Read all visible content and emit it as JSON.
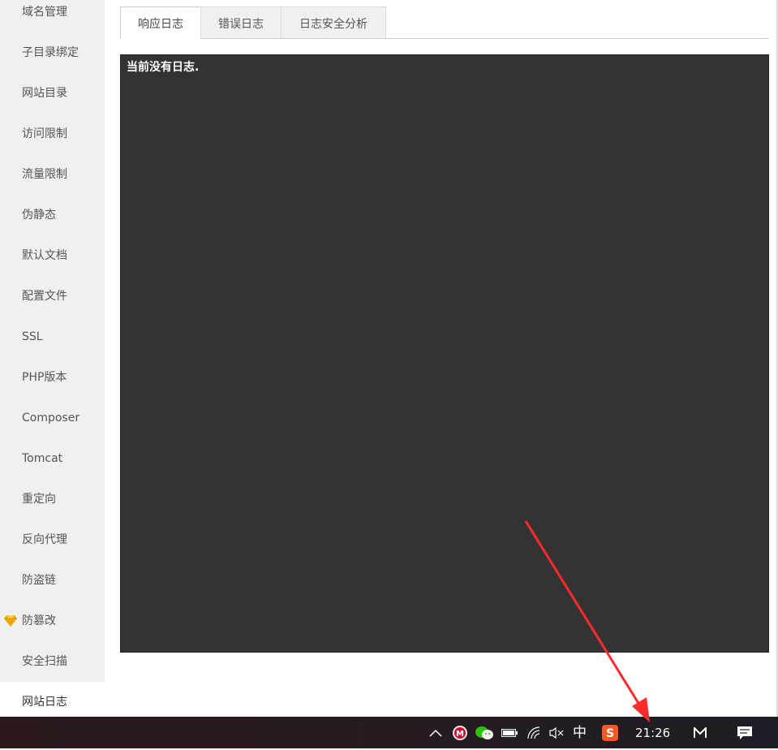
{
  "sidebar": {
    "items": [
      {
        "label": "域名管理"
      },
      {
        "label": "子目录绑定"
      },
      {
        "label": "网站目录"
      },
      {
        "label": "访问限制"
      },
      {
        "label": "流量限制"
      },
      {
        "label": "伪静态"
      },
      {
        "label": "默认文档"
      },
      {
        "label": "配置文件"
      },
      {
        "label": "SSL"
      },
      {
        "label": "PHP版本"
      },
      {
        "label": "Composer"
      },
      {
        "label": "Tomcat"
      },
      {
        "label": "重定向"
      },
      {
        "label": "反向代理"
      },
      {
        "label": "防盗链"
      },
      {
        "label": "防篡改"
      },
      {
        "label": "安全扫描"
      },
      {
        "label": "网站日志"
      }
    ],
    "active_index": 17,
    "premium_icon_color": "#f0a800"
  },
  "tabs": [
    {
      "label": "响应日志"
    },
    {
      "label": "错误日志"
    },
    {
      "label": "日志安全分析"
    }
  ],
  "log": {
    "text": "当前没有日志."
  },
  "taskbar": {
    "ime": "中",
    "clock": "21:26",
    "icons": [
      "chevron-up-icon",
      "mcafee-icon",
      "wechat-icon",
      "battery-icon",
      "wifi-icon",
      "volume-muted-icon",
      "sogou-icon",
      "app-icon",
      "notification-icon"
    ]
  },
  "annotation": {
    "arrow_color": "#ff2a2a"
  }
}
